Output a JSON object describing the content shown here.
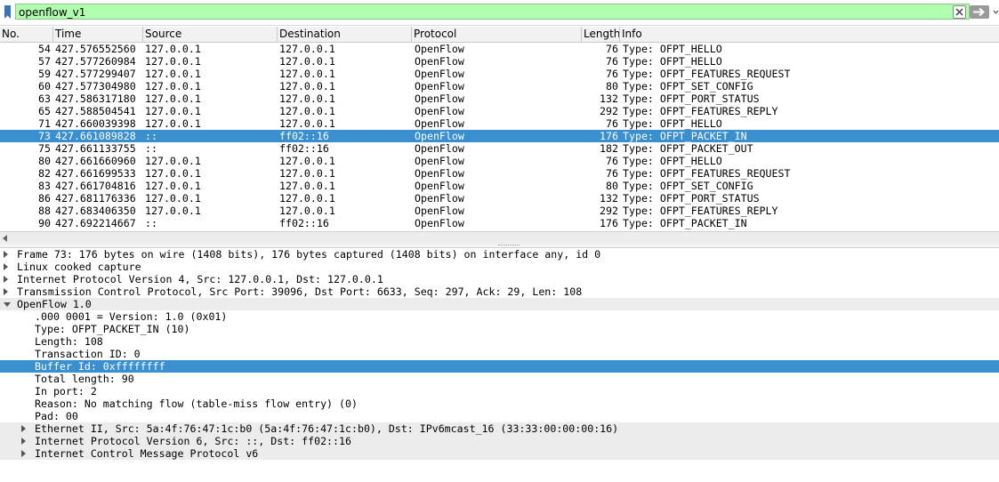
{
  "filter": {
    "value": "openflow_v1"
  },
  "packet_list": {
    "columns": [
      {
        "key": "no",
        "label": "No."
      },
      {
        "key": "time",
        "label": "Time"
      },
      {
        "key": "source",
        "label": "Source"
      },
      {
        "key": "destination",
        "label": "Destination"
      },
      {
        "key": "protocol",
        "label": "Protocol"
      },
      {
        "key": "length",
        "label": "Length"
      },
      {
        "key": "info",
        "label": "Info"
      }
    ],
    "rows": [
      {
        "no": "54",
        "time": "427.576552560",
        "source": "127.0.0.1",
        "destination": "127.0.0.1",
        "protocol": "OpenFlow",
        "length": "76",
        "info": "Type: OFPT_HELLO"
      },
      {
        "no": "57",
        "time": "427.577260984",
        "source": "127.0.0.1",
        "destination": "127.0.0.1",
        "protocol": "OpenFlow",
        "length": "76",
        "info": "Type: OFPT_HELLO"
      },
      {
        "no": "59",
        "time": "427.577299407",
        "source": "127.0.0.1",
        "destination": "127.0.0.1",
        "protocol": "OpenFlow",
        "length": "76",
        "info": "Type: OFPT_FEATURES_REQUEST"
      },
      {
        "no": "60",
        "time": "427.577304980",
        "source": "127.0.0.1",
        "destination": "127.0.0.1",
        "protocol": "OpenFlow",
        "length": "80",
        "info": "Type: OFPT_SET_CONFIG"
      },
      {
        "no": "63",
        "time": "427.586317180",
        "source": "127.0.0.1",
        "destination": "127.0.0.1",
        "protocol": "OpenFlow",
        "length": "132",
        "info": "Type: OFPT_PORT_STATUS"
      },
      {
        "no": "65",
        "time": "427.588504541",
        "source": "127.0.0.1",
        "destination": "127.0.0.1",
        "protocol": "OpenFlow",
        "length": "292",
        "info": "Type: OFPT_FEATURES_REPLY"
      },
      {
        "no": "71",
        "time": "427.660039398",
        "source": "127.0.0.1",
        "destination": "127.0.0.1",
        "protocol": "OpenFlow",
        "length": "76",
        "info": "Type: OFPT_HELLO"
      },
      {
        "no": "73",
        "time": "427.661089828",
        "source": "::",
        "destination": "ff02::16",
        "protocol": "OpenFlow",
        "length": "176",
        "info": "Type: OFPT_PACKET_IN",
        "selected": true
      },
      {
        "no": "75",
        "time": "427.661133755",
        "source": "::",
        "destination": "ff02::16",
        "protocol": "OpenFlow",
        "length": "182",
        "info": "Type: OFPT_PACKET_OUT"
      },
      {
        "no": "80",
        "time": "427.661660960",
        "source": "127.0.0.1",
        "destination": "127.0.0.1",
        "protocol": "OpenFlow",
        "length": "76",
        "info": "Type: OFPT_HELLO"
      },
      {
        "no": "82",
        "time": "427.661699533",
        "source": "127.0.0.1",
        "destination": "127.0.0.1",
        "protocol": "OpenFlow",
        "length": "76",
        "info": "Type: OFPT_FEATURES_REQUEST"
      },
      {
        "no": "83",
        "time": "427.661704816",
        "source": "127.0.0.1",
        "destination": "127.0.0.1",
        "protocol": "OpenFlow",
        "length": "80",
        "info": "Type: OFPT_SET_CONFIG"
      },
      {
        "no": "86",
        "time": "427.681176336",
        "source": "127.0.0.1",
        "destination": "127.0.0.1",
        "protocol": "OpenFlow",
        "length": "132",
        "info": "Type: OFPT_PORT_STATUS"
      },
      {
        "no": "88",
        "time": "427.683406350",
        "source": "127.0.0.1",
        "destination": "127.0.0.1",
        "protocol": "OpenFlow",
        "length": "292",
        "info": "Type: OFPT_FEATURES_REPLY"
      },
      {
        "no": "90",
        "time": "427.692214667",
        "source": "::",
        "destination": "ff02::16",
        "protocol": "OpenFlow",
        "length": "176",
        "info": "Type: OFPT_PACKET_IN"
      }
    ]
  },
  "details": [
    {
      "text": "Frame 73: 176 bytes on wire (1408 bits), 176 bytes captured (1408 bits) on interface any, id 0",
      "expander": "collapsed",
      "level": 0,
      "shade": false
    },
    {
      "text": "Linux cooked capture",
      "expander": "collapsed",
      "level": 0,
      "shade": false
    },
    {
      "text": "Internet Protocol Version 4, Src: 127.0.0.1, Dst: 127.0.0.1",
      "expander": "collapsed",
      "level": 0,
      "shade": false
    },
    {
      "text": "Transmission Control Protocol, Src Port: 39096, Dst Port: 6633, Seq: 297, Ack: 29, Len: 108",
      "expander": "collapsed",
      "level": 0,
      "shade": false
    },
    {
      "text": "OpenFlow 1.0",
      "expander": "expanded",
      "level": 0,
      "shade": true
    },
    {
      "text": ".000 0001 = Version: 1.0 (0x01)",
      "expander": "none",
      "level": 1,
      "shade": false
    },
    {
      "text": "Type: OFPT_PACKET_IN (10)",
      "expander": "none",
      "level": 1,
      "shade": false
    },
    {
      "text": "Length: 108",
      "expander": "none",
      "level": 1,
      "shade": false
    },
    {
      "text": "Transaction ID: 0",
      "expander": "none",
      "level": 1,
      "shade": false
    },
    {
      "text": "Buffer Id: 0xffffffff",
      "expander": "none",
      "level": 1,
      "shade": false,
      "selected": true
    },
    {
      "text": "Total length: 90",
      "expander": "none",
      "level": 1,
      "shade": false
    },
    {
      "text": "In port: 2",
      "expander": "none",
      "level": 1,
      "shade": false
    },
    {
      "text": "Reason: No matching flow (table-miss flow entry) (0)",
      "expander": "none",
      "level": 1,
      "shade": false
    },
    {
      "text": "Pad: 00",
      "expander": "none",
      "level": 1,
      "shade": false
    },
    {
      "text": "Ethernet II, Src: 5a:4f:76:47:1c:b0 (5a:4f:76:47:1c:b0), Dst: IPv6mcast_16 (33:33:00:00:00:16)",
      "expander": "collapsed",
      "level": 1,
      "shade": true
    },
    {
      "text": "Internet Protocol Version 6, Src: ::, Dst: ff02::16",
      "expander": "collapsed",
      "level": 1,
      "shade": true
    },
    {
      "text": "Internet Control Message Protocol v6",
      "expander": "collapsed",
      "level": 1,
      "shade": true
    }
  ],
  "colors": {
    "selection": "#3a8fcf",
    "filter_valid": "#afffaf"
  }
}
